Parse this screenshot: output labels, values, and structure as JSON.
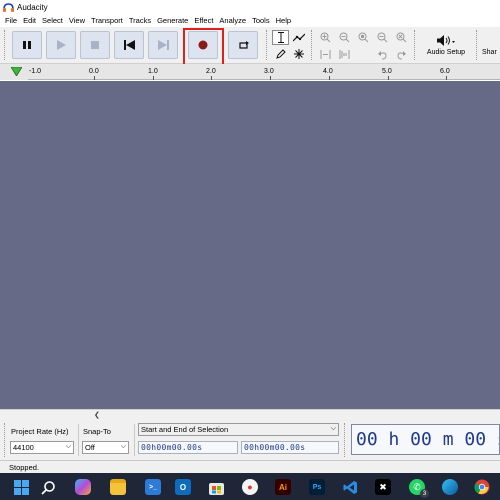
{
  "window": {
    "title": "Audacity"
  },
  "menu": [
    "File",
    "Edit",
    "Select",
    "View",
    "Transport",
    "Tracks",
    "Generate",
    "Effect",
    "Analyze",
    "Tools",
    "Help"
  ],
  "toolbar": {
    "audio_setup_label": "Audio Setup",
    "share_label": "Shar",
    "buttons": [
      "pause",
      "play",
      "stop",
      "skip-to-start",
      "skip-to-end",
      "record",
      "loop"
    ],
    "highlighted_button": "record",
    "record_color": "#8b1a1a",
    "highlight_color": "#e0201c"
  },
  "ruler": {
    "ticks": [
      "1.0",
      "0.0",
      "1.0",
      "2.0",
      "3.0",
      "4.0",
      "5.0",
      "6.0"
    ],
    "first_tick_prefix": "-"
  },
  "track_area": {
    "background": "#676a86"
  },
  "selection_toolbar": {
    "project_rate_label": "Project Rate (Hz)",
    "project_rate_value": "44100",
    "snap_to_label": "Snap-To",
    "snap_to_value": "Off",
    "selection_mode": "Start and End of Selection",
    "start_time": "00h00m00.00s",
    "end_time": "00h00m00.00s",
    "big_time": "00 h 00 m 00 s"
  },
  "status": {
    "text": "Stopped."
  },
  "taskbar": {
    "icons": [
      "windows-start",
      "search",
      "copilot",
      "file-explorer",
      "terminal",
      "outlook",
      "microsoft-store",
      "paint",
      "illustrator",
      "photoshop",
      "vscode",
      "capcut",
      "whatsapp",
      "edge",
      "chrome"
    ],
    "whatsapp_badge": "3"
  }
}
